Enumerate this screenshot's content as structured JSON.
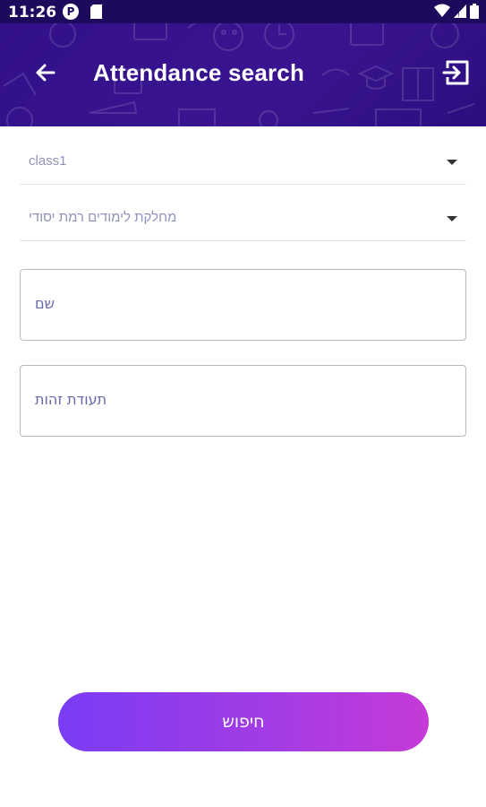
{
  "status_bar": {
    "time": "11:26",
    "notification_icon_letter": "P",
    "icons": [
      "wifi-icon",
      "signal-icon",
      "battery-icon"
    ]
  },
  "app_bar": {
    "title": "Attendance search",
    "back_icon": "arrow-left-icon",
    "logout_icon": "exit-icon",
    "background_color": "#32108a"
  },
  "form": {
    "class_select": {
      "value": "class1"
    },
    "department_select": {
      "value": "מחלקת לימודים רמת יסודי"
    },
    "name_field": {
      "label": "שם",
      "value": ""
    },
    "id_field": {
      "label": "תעודת זהות",
      "value": ""
    }
  },
  "search_button": {
    "label": "חיפוש"
  },
  "colors": {
    "accent_start": "#7a3cf5",
    "accent_end": "#c63ad8",
    "field_text": "#6468a8",
    "select_text": "#8f93b8"
  }
}
